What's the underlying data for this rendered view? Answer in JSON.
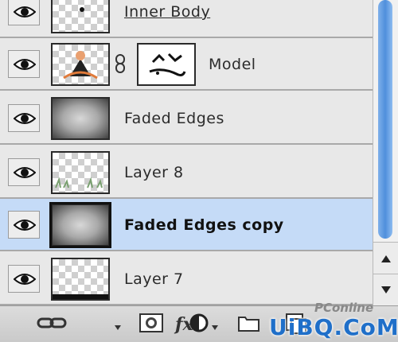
{
  "layers": [
    {
      "name": "Inner Body",
      "visible": true,
      "selected": false,
      "thumb": "transparent-with-dot",
      "style": "underline"
    },
    {
      "name": "Model",
      "visible": true,
      "selected": false,
      "thumb": "model",
      "linked_mask": true
    },
    {
      "name": "Faded Edges",
      "visible": true,
      "selected": false,
      "thumb": "faded"
    },
    {
      "name": "Layer 8",
      "visible": true,
      "selected": false,
      "thumb": "transparent-grass"
    },
    {
      "name": "Faded Edges copy",
      "visible": true,
      "selected": true,
      "thumb": "faded"
    },
    {
      "name": "Layer 7",
      "visible": true,
      "selected": false,
      "thumb": "transparent-bottom-bar"
    }
  ],
  "toolbar": {
    "icons": [
      "link-layers-icon",
      "fx-icon",
      "layer-mask-icon",
      "adjustment-layer-icon",
      "new-group-icon",
      "new-layer-icon"
    ],
    "fx_label": "fx"
  },
  "watermark": {
    "line1": "PConline",
    "line2": "UiBQ.CoM"
  },
  "colors": {
    "selected_row": "#c5dbf7",
    "scrollbar_thumb": "#4f8fdc",
    "watermark": "#1f6fc9"
  }
}
